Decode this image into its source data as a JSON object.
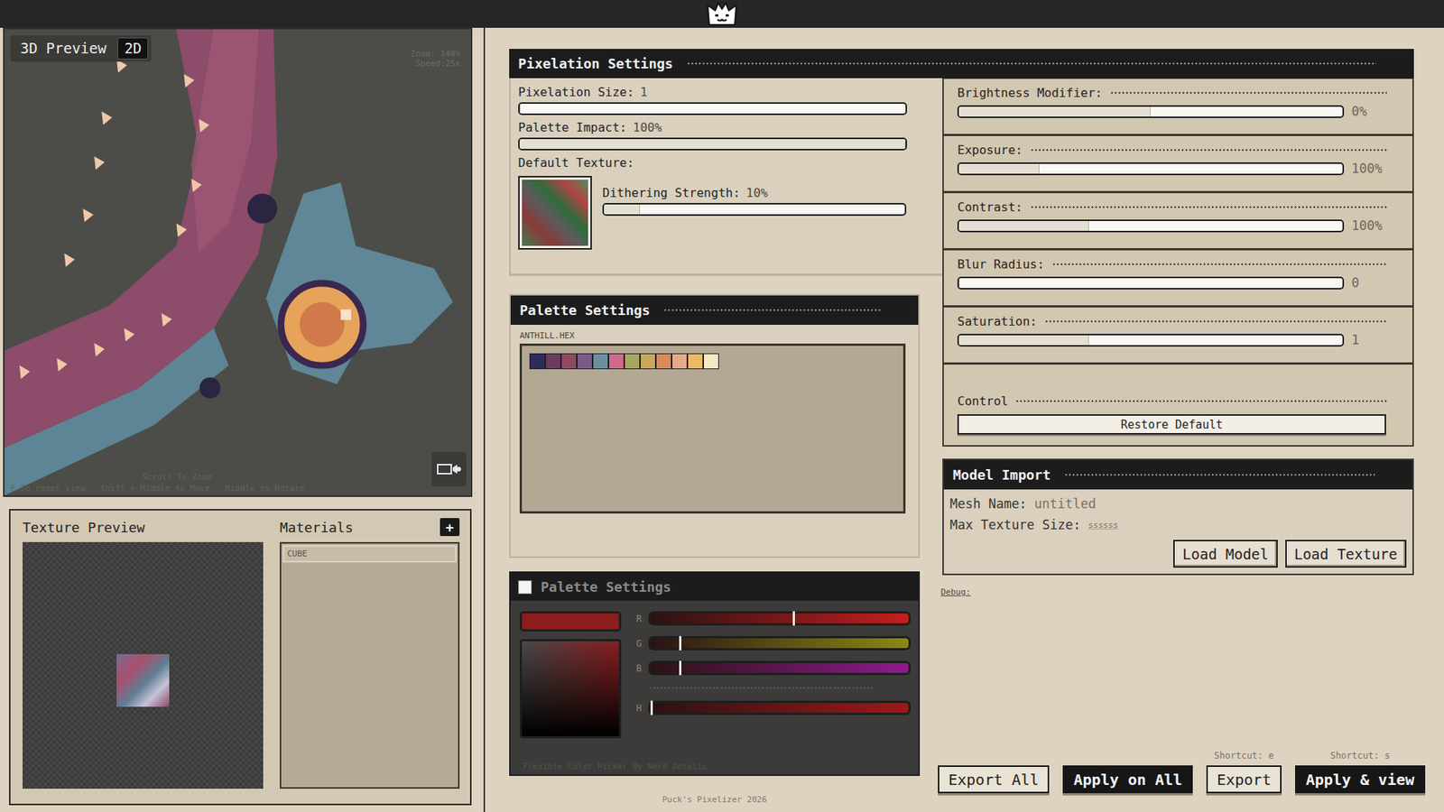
{
  "preview": {
    "tabs": [
      {
        "label": "3D Preview",
        "selected": true
      },
      {
        "label": "2D",
        "selected": false
      }
    ],
    "zoom": "Zoom: 140%",
    "speed": "Speed:25x",
    "hint_top": "Scroll To Zoom",
    "hints": [
      "F To reset view",
      "Shift + Middle to Move",
      "Middle to Rotate"
    ]
  },
  "texture_preview": {
    "title": "Texture Preview"
  },
  "materials": {
    "title": "Materials",
    "add": "+",
    "items": [
      {
        "name": "CUBE",
        "selected": true
      }
    ]
  },
  "pixelation": {
    "title": "Pixelation Settings",
    "sliders": [
      {
        "label": "Pixelation Size:",
        "value": "1",
        "level": 0.0
      },
      {
        "label": "Palette Impact:",
        "value": "100%",
        "level": 1.0
      }
    ],
    "default_texture": "Default Texture:",
    "dithering": {
      "label": "Dithering Strength:",
      "value": "10%",
      "level": 0.12
    }
  },
  "adjustments": [
    {
      "label": "Brightness Modifier:",
      "reading": "0%",
      "level": 0.5
    },
    {
      "label": "Exposure:",
      "reading": "100%",
      "level": 0.21
    },
    {
      "label": "Contrast:",
      "reading": "100%",
      "level": 0.34
    },
    {
      "label": "Blur Radius:",
      "reading": "0",
      "level": 0.0
    },
    {
      "label": "Saturation:",
      "reading": "1",
      "level": 0.34
    }
  ],
  "control": {
    "label": "Control",
    "button": "Restore Default"
  },
  "palette": {
    "title": "Palette Settings",
    "file": "ANTHILL.HEX",
    "colors": [
      {
        "color": "#2e2a5a"
      },
      {
        "color": "#6b3a5e"
      },
      {
        "color": "#8f4a62"
      },
      {
        "color": "#7b5a8a"
      },
      {
        "color": "#6a8fa3"
      },
      {
        "color": "#d06a8a"
      },
      {
        "color": "#a7a65f"
      },
      {
        "color": "#c9a85a"
      },
      {
        "color": "#d98a5a"
      },
      {
        "color": "#e8a888"
      },
      {
        "color": "#f0b860"
      },
      {
        "color": "#f8e8c0"
      }
    ]
  },
  "picker": {
    "title": "Palette Settings",
    "enabled": false,
    "value": "#8b1d1d",
    "channels": [
      {
        "label": "R",
        "level": 0.55,
        "color": "#c41e1e"
      },
      {
        "label": "G",
        "level": 0.11,
        "color": "#8a8a14"
      },
      {
        "label": "B",
        "level": 0.11,
        "color": "#8e1a8e"
      },
      {
        "label": "H",
        "level": 0.0,
        "color": "#a01818"
      }
    ],
    "credit": "Flexible Color Picker By Nerd Details"
  },
  "model_import": {
    "title": "Model Import",
    "fields": [
      {
        "label": "Mesh Name:",
        "value": "untitled"
      },
      {
        "label": "Max Texture Size:",
        "value": "ssssss"
      }
    ],
    "buttons": [
      "Load Model",
      "Load Texture"
    ]
  },
  "debug": "Debug:",
  "actions": [
    {
      "label": "Export All",
      "shortcut": null,
      "kind": "outline"
    },
    {
      "label": "Apply on All",
      "shortcut": null,
      "kind": "filled"
    },
    {
      "label": "Export",
      "shortcut": "Shortcut: e",
      "kind": "outline"
    },
    {
      "label": "Apply & view",
      "shortcut": "Shortcut: s",
      "kind": "filled"
    }
  ],
  "footer": "Puck's Pixelizer 2026"
}
